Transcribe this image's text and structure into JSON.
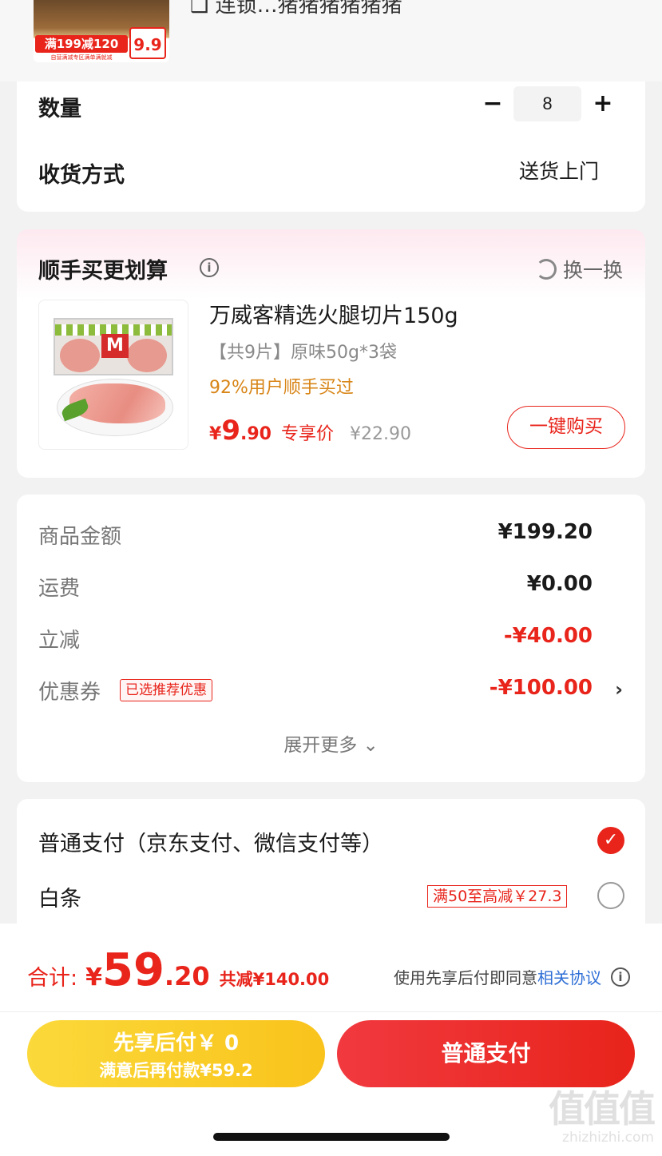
{
  "top_product": {
    "title": "❑ 连锁…猪猪猪猪猪猪",
    "promo": "满199减120",
    "promo_sub": "自营满减专区满单满就减",
    "price_tag": "9.9"
  },
  "order": {
    "quantity_label": "数量",
    "quantity_value": "8",
    "minus": "−",
    "plus": "+",
    "delivery_label": "收货方式",
    "delivery_value": "送货上门"
  },
  "upsell": {
    "title": "顺手买更划算",
    "info": "i",
    "swap_label": "换一换",
    "product_name": "万威客精选火腿切片150g",
    "spec": "【共9片】原味50g*3袋",
    "buyers": "92%用户顺手买过",
    "price_symbol": "¥",
    "price_int": "9",
    "price_dec": ".90",
    "price_label": "专享价",
    "original_price": "¥22.90",
    "buy_button": "一键购买"
  },
  "summary": {
    "items": [
      {
        "label": "商品金额",
        "value": "¥199.20"
      },
      {
        "label": "运费",
        "value": "¥0.00"
      },
      {
        "label": "立减",
        "value": "-¥40.00"
      },
      {
        "label": "优惠券",
        "value": "-¥100.00"
      }
    ],
    "coupon_tag": "已选推荐优惠",
    "chevron": "›",
    "expand": "展开更多 ⌄"
  },
  "payment": {
    "standard_label": "普通支付（京东支付、微信支付等）",
    "baitiao_label": "白条",
    "baitiao_tag": "满50至高减￥27.3",
    "check_mark": "✓"
  },
  "footer": {
    "total_label": "合计:",
    "total_symbol": "¥",
    "total_int": "59",
    "total_dec": ".20",
    "total_saved": "共减¥140.00",
    "agree_text": "使用先享后付即同意",
    "agree_link": "相关协议",
    "later_line1": "先享后付￥ 0",
    "later_line2": "满意后再付款¥59.2",
    "pay_button": "普通支付"
  },
  "watermark": {
    "chars": "值值值",
    "url": "zhizhizhi.com"
  },
  "colors": {
    "accent_red": "#e8241b",
    "orange": "#d88517",
    "link_blue": "#2f6fd6",
    "yellow": "#f9c31b"
  }
}
